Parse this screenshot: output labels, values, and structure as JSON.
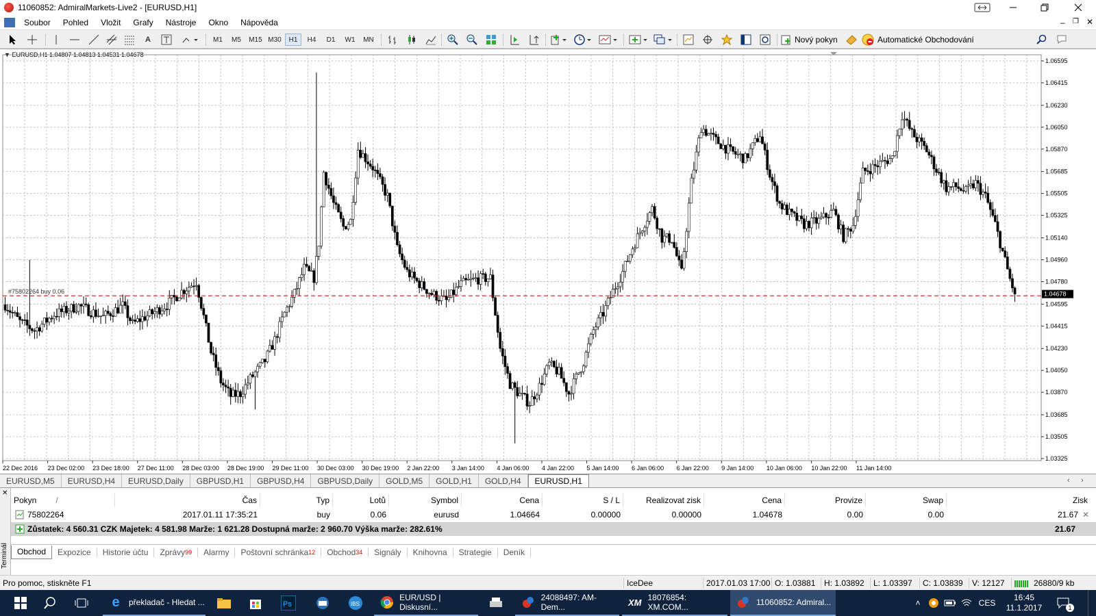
{
  "window": {
    "title": "11060852: AdmiralMarkets-Live2 - [EURUSD,H1]"
  },
  "menu": [
    "Soubor",
    "Pohled",
    "Vložit",
    "Grafy",
    "Nástroje",
    "Okno",
    "Nápověda"
  ],
  "toolbar": {
    "timeframes": [
      "M1",
      "M5",
      "M15",
      "M30",
      "H1",
      "H4",
      "D1",
      "W1",
      "MN"
    ],
    "active_timeframe": "H1",
    "new_order_label": "Nový pokyn",
    "auto_trading_label": "Automatické Obchodování"
  },
  "chart_header": "EURUSD,H1  1.04807 1.04813 1.04531 1.04678",
  "chart_data": {
    "type": "candlestick",
    "symbol": "EURUSD",
    "timeframe": "H1",
    "ohlc_last": {
      "open": 1.04807,
      "high": 1.04813,
      "low": 1.04531,
      "close": 1.04678
    },
    "price_ticks": [
      "1.06595",
      "1.06415",
      "1.06230",
      "1.06050",
      "1.05870",
      "1.05685",
      "1.05505",
      "1.05325",
      "1.05140",
      "1.04960",
      "1.04780",
      "1.04595",
      "1.04415",
      "1.04230",
      "1.04050",
      "1.03870",
      "1.03685",
      "1.03505",
      "1.03325"
    ],
    "time_ticks": [
      "22 Dec 2016",
      "23 Dec 02:00",
      "23 Dec 18:00",
      "27 Dec 11:00",
      "28 Dec 03:00",
      "28 Dec 19:00",
      "29 Dec 11:00",
      "30 Dec 03:00",
      "30 Dec 19:00",
      "2 Jan 22:00",
      "3 Jan 14:00",
      "4 Jan 06:00",
      "4 Jan 22:00",
      "5 Jan 14:00",
      "6 Jan 06:00",
      "6 Jan 22:00",
      "9 Jan 14:00",
      "10 Jan 06:00",
      "10 Jan 22:00",
      "11 Jan 14:00"
    ],
    "current_price_label": "1.04678",
    "order_line_label": "#75802264 buy 0.06",
    "order_line_price": 1.04664,
    "path": [
      [
        0,
        1.0459
      ],
      [
        6,
        1.0445
      ],
      [
        12,
        1.0438
      ],
      [
        20,
        1.0451
      ],
      [
        30,
        1.0458
      ],
      [
        40,
        1.0449
      ],
      [
        48,
        1.0458
      ],
      [
        52,
        1.0443
      ],
      [
        56,
        1.0448
      ],
      [
        60,
        1.0452
      ],
      [
        66,
        1.0459
      ],
      [
        72,
        1.047
      ],
      [
        78,
        1.0478
      ],
      [
        80,
        1.0459
      ],
      [
        84,
        1.042
      ],
      [
        88,
        1.0396
      ],
      [
        92,
        1.0384
      ],
      [
        96,
        1.0386
      ],
      [
        100,
        1.0398
      ],
      [
        106,
        1.0413
      ],
      [
        110,
        1.043
      ],
      [
        114,
        1.0452
      ],
      [
        118,
        1.0468
      ],
      [
        122,
        1.0489
      ],
      [
        126,
        1.0481
      ],
      [
        128,
        1.051
      ],
      [
        130,
        1.0568
      ],
      [
        134,
        1.0542
      ],
      [
        138,
        1.0523
      ],
      [
        141,
        1.0528
      ],
      [
        144,
        1.0587
      ],
      [
        150,
        1.0572
      ],
      [
        156,
        1.0548
      ],
      [
        160,
        1.0505
      ],
      [
        164,
        1.0486
      ],
      [
        168,
        1.0478
      ],
      [
        174,
        1.0468
      ],
      [
        180,
        1.0462
      ],
      [
        186,
        1.0476
      ],
      [
        192,
        1.048
      ],
      [
        198,
        1.0481
      ],
      [
        202,
        1.0423
      ],
      [
        206,
        1.0394
      ],
      [
        210,
        1.0385
      ],
      [
        214,
        1.0378
      ],
      [
        218,
        1.0392
      ],
      [
        222,
        1.041
      ],
      [
        226,
        1.0403
      ],
      [
        230,
        1.0386
      ],
      [
        236,
        1.0412
      ],
      [
        240,
        1.0438
      ],
      [
        244,
        1.0452
      ],
      [
        248,
        1.047
      ],
      [
        252,
        1.0486
      ],
      [
        256,
        1.0506
      ],
      [
        260,
        1.0523
      ],
      [
        264,
        1.0538
      ],
      [
        268,
        1.0514
      ],
      [
        272,
        1.0513
      ],
      [
        276,
        1.0485
      ],
      [
        280,
        1.056
      ],
      [
        284,
        1.0605
      ],
      [
        290,
        1.0594
      ],
      [
        296,
        1.0585
      ],
      [
        302,
        1.0579
      ],
      [
        308,
        1.0599
      ],
      [
        312,
        1.0566
      ],
      [
        316,
        1.0542
      ],
      [
        320,
        1.0534
      ],
      [
        326,
        1.0525
      ],
      [
        332,
        1.0528
      ],
      [
        338,
        1.0536
      ],
      [
        342,
        1.0515
      ],
      [
        346,
        1.0525
      ],
      [
        350,
        1.0568
      ],
      [
        356,
        1.0574
      ],
      [
        362,
        1.058
      ],
      [
        366,
        1.0615
      ],
      [
        370,
        1.06
      ],
      [
        376,
        1.0586
      ],
      [
        380,
        1.057
      ],
      [
        384,
        1.0555
      ],
      [
        388,
        1.0556
      ],
      [
        392,
        1.0552
      ],
      [
        396,
        1.0559
      ],
      [
        400,
        1.0548
      ],
      [
        404,
        1.0525
      ],
      [
        408,
        1.0495
      ],
      [
        410,
        1.048
      ],
      [
        412,
        1.0468
      ]
    ]
  },
  "chart_tabs": [
    "EURUSD,M5",
    "EURUSD,H4",
    "EURUSD,Daily",
    "GBPUSD,H1",
    "GBPUSD,H4",
    "GBPUSD,Daily",
    "GOLD,M5",
    "GOLD,H1",
    "GOLD,H4",
    "EURUSD,H1"
  ],
  "active_chart_tab": "EURUSD,H1",
  "terminal": {
    "side_label": "Terminál",
    "columns": [
      "Pokyn",
      "Čas",
      "Typ",
      "Lotů",
      "Symbol",
      "Cena",
      "S / L",
      "Realizovat zisk",
      "Cena",
      "Provize",
      "Swap",
      "Zisk"
    ],
    "row": [
      "75802264",
      "2017.01.11 17:35:21",
      "buy",
      "0.06",
      "eurusd",
      "1.04664",
      "0.00000",
      "0.00000",
      "1.04678",
      "0.00",
      "0.00",
      "21.67"
    ],
    "balance_text": "Zůstatek: 4 560.31 CZK  Majetek: 4 581.98  Marže: 1 621.28  Dostupná marže: 2 960.70  Výška marže: 282.61%",
    "balance_profit": "21.67",
    "tabs": [
      {
        "label": "Obchod",
        "badge": ""
      },
      {
        "label": "Expozice",
        "badge": ""
      },
      {
        "label": "Historie účtu",
        "badge": ""
      },
      {
        "label": "Zprávy",
        "badge": "99"
      },
      {
        "label": "Alarmy",
        "badge": ""
      },
      {
        "label": "Poštovní schránka",
        "badge": "12"
      },
      {
        "label": "Obchod",
        "badge": "34"
      },
      {
        "label": "Signály",
        "badge": ""
      },
      {
        "label": "Knihovna",
        "badge": ""
      },
      {
        "label": "Strategie",
        "badge": ""
      },
      {
        "label": "Deník",
        "badge": ""
      }
    ]
  },
  "status": {
    "help": "Pro pomoc, stiskněte F1",
    "profile": "IceDee",
    "time": "2017.01.03 17:00",
    "open": "O: 1.03881",
    "high": "H: 1.03892",
    "low": "L: 1.03397",
    "close": "C: 1.03839",
    "volume": "V: 12127",
    "traffic": "26880/9 kb"
  },
  "taskbar": {
    "apps": [
      "překladač - Hledat ...",
      "EUR/USD | Diskusní...",
      "24088497: AM-Dem...",
      "18076854: XM.COM...",
      "11060852: Admiral..."
    ],
    "lang": "CES",
    "clock_time": "16:45",
    "clock_date": "11.1.2017",
    "notif_count": "1"
  },
  "colors": {
    "bull": "#ffffff",
    "bear": "#000000",
    "grid": "#c0c0c0",
    "order_line": "#c00000",
    "taskbar": "#10233e"
  }
}
